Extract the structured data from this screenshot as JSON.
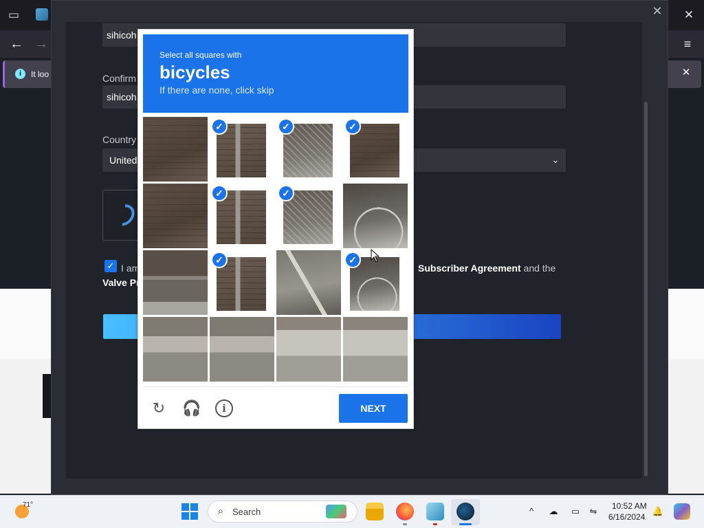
{
  "browser": {
    "overview_icon": "tab-overview-icon",
    "close_glyph": "✕",
    "back_glyph": "←",
    "forward_glyph": "→",
    "menu_glyph": "≡",
    "infobar_text": "It loo",
    "infobar_close": "✕"
  },
  "steam": {
    "close_glyph": "✕",
    "password_value": "sihicoh",
    "confirm_label": "Confirm",
    "confirm_value": "sihicoh",
    "country_label": "Country",
    "country_value": "United",
    "agree_prefix": "I am",
    "agree_link": "Subscriber Agreement",
    "agree_suffix": " and the",
    "privacy_text": "Valve Pr"
  },
  "captcha": {
    "instruction": "Select all squares with",
    "object": "bicycles",
    "hint": "If there are none, click skip",
    "tiles": [
      {
        "row": 0,
        "col": 0,
        "selected": false,
        "texture": "brick"
      },
      {
        "row": 0,
        "col": 1,
        "selected": true,
        "texture": "pole"
      },
      {
        "row": 0,
        "col": 2,
        "selected": true,
        "texture": "basket"
      },
      {
        "row": 0,
        "col": 3,
        "selected": true,
        "texture": "brick"
      },
      {
        "row": 1,
        "col": 0,
        "selected": false,
        "texture": "brick"
      },
      {
        "row": 1,
        "col": 1,
        "selected": true,
        "texture": "pole"
      },
      {
        "row": 1,
        "col": 2,
        "selected": true,
        "texture": "basket"
      },
      {
        "row": 1,
        "col": 3,
        "selected": false,
        "texture": "wheel"
      },
      {
        "row": 2,
        "col": 0,
        "selected": false,
        "texture": "step"
      },
      {
        "row": 2,
        "col": 1,
        "selected": true,
        "texture": "pole"
      },
      {
        "row": 2,
        "col": 2,
        "selected": false,
        "texture": "frame"
      },
      {
        "row": 2,
        "col": 3,
        "selected": true,
        "texture": "wheel"
      },
      {
        "row": 3,
        "col": 0,
        "selected": false,
        "texture": "curb"
      },
      {
        "row": 3,
        "col": 1,
        "selected": false,
        "texture": "curb"
      },
      {
        "row": 3,
        "col": 2,
        "selected": false,
        "texture": "ground"
      },
      {
        "row": 3,
        "col": 3,
        "selected": false,
        "texture": "ground"
      }
    ],
    "check_glyph": "✓",
    "reload_icon": "reload-icon",
    "audio_icon": "headphones-icon",
    "info_icon": "info-icon",
    "reload_glyph": "↻",
    "audio_glyph": "🎧",
    "info_glyph": "i",
    "next_label": "NEXT",
    "accent_color": "#1a73e8"
  },
  "taskbar": {
    "weather_temp": "71°",
    "search_placeholder": "Search",
    "search_glyph": "⌕",
    "tray_chevron": "^",
    "tray_cloud": "☁",
    "tray_display": "▭",
    "tray_net": "⇋",
    "time": "10:52 AM",
    "date": "6/16/2024",
    "bell_glyph": "🔔"
  }
}
